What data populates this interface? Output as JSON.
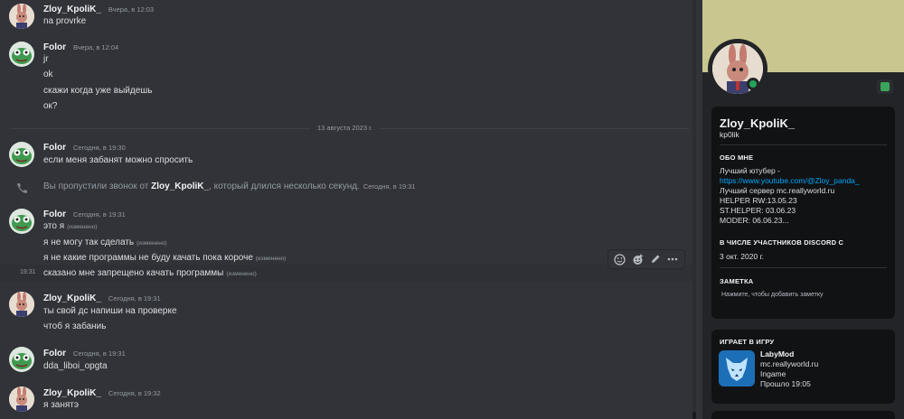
{
  "chat": {
    "messages": [
      {
        "author": "Zloy_KpoliK_",
        "time": "Вчера, в 12:03",
        "lines": [
          "na provrke"
        ]
      },
      {
        "author": "Folor",
        "time": "Вчера, в 12:04",
        "lines": [
          "jr",
          "ok",
          "скажи когда уже выйдешь",
          "ок?"
        ]
      },
      {
        "author": "Folor",
        "time": "Сегодня, в 19:30",
        "lines": [
          "если меня забанят можно спросить"
        ]
      },
      {
        "author": "Folor",
        "time": "Сегодня, в 19:31",
        "lines": [
          "это я",
          "я не могу так сделать",
          "я не какие программы не буду качать пока короче",
          "сказано мне запрещено качать программы"
        ]
      },
      {
        "author": "Zloy_KpoliK_",
        "time": "Сегодня, в 19:31",
        "lines": [
          "ты свой дс напиши на проверке",
          "чтоб я забаниь"
        ]
      },
      {
        "author": "Folor",
        "time": "Сегодня, в 19:31",
        "lines": [
          "dda_liboi_opgta"
        ]
      },
      {
        "author": "Zloy_KpoliK_",
        "time": "Сегодня, в 19:32",
        "lines": [
          "я занятэ"
        ]
      }
    ],
    "edited_label": "(изменено)",
    "date_divider": "13 августа 2023 г.",
    "missed_call": {
      "prefix": "Вы пропустили звонок от",
      "caller": "Zloy_KpoliK_",
      "suffix": ", который длился несколько секунд.",
      "time": "Сегодня, в 19:31"
    },
    "hover_time": "19:31",
    "toolbar_icons": [
      "add-reaction-icon",
      "super-reaction-icon",
      "edit-icon",
      "more-icon"
    ]
  },
  "profile": {
    "display_name": "Zloy_KpoliK_",
    "username": "kp0lik",
    "about_title": "ОБО МНЕ",
    "about_line1": "Лучший ютубер -",
    "about_link": "https://www.youtube.com/@Zloy_panda_",
    "about_line3": "Лучший сервер mc.reallyworld.ru",
    "about_line4": "HELPER RW:13.05.23",
    "about_line5": "ST.HELPER: 03.06.23",
    "about_line6": "MODER: 06.06.23...",
    "member_since_title": "В ЧИСЛЕ УЧАСТНИКОВ DISCORD С",
    "member_since": "3 окт. 2020 г.",
    "note_title": "ЗАМЕТКА",
    "note_placeholder": "Нажмите, чтобы добавить заметку",
    "activity_title": "ИГРАЕТ В ИГРУ",
    "game_name": "LabyMod",
    "game_server": "mc.reallyworld.ru",
    "game_state": "Ingame",
    "game_elapsed": "Прошло 19:05",
    "status_color": "#23a559",
    "banner_color": "#c9c68f",
    "link_color": "#00a8fc"
  }
}
